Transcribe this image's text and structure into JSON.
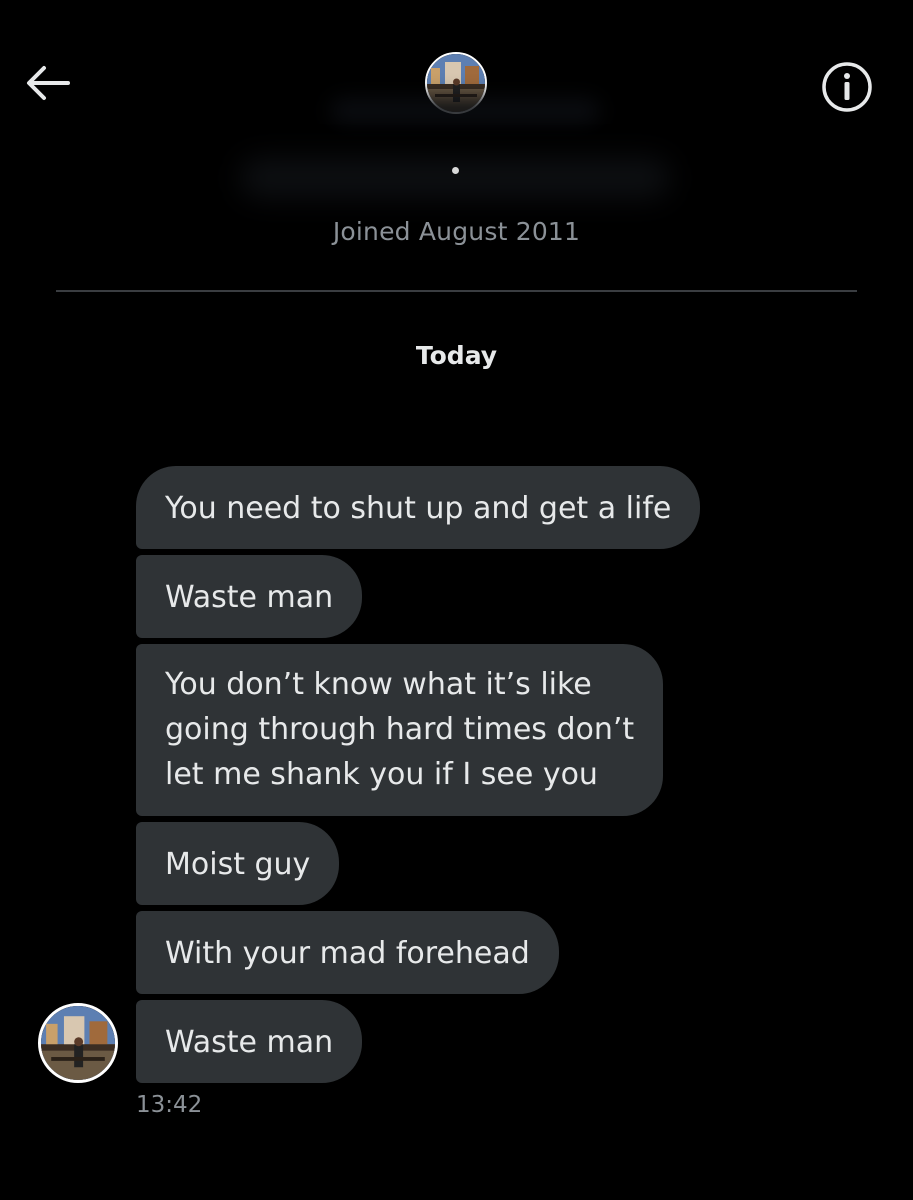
{
  "header": {
    "back_icon": "arrow-left-icon",
    "info_icon": "info-circle-icon",
    "joined_text": "Joined August 2011"
  },
  "conversation": {
    "day_label": "Today",
    "messages": [
      {
        "text": "You need to shut up and get a life"
      },
      {
        "text": "Waste man"
      },
      {
        "text": "You don’t know what it’s like\ngoing through hard times don’t\nlet me shank you if I see you"
      },
      {
        "text": "Moist guy"
      },
      {
        "text": "With your mad forehead"
      },
      {
        "text": "Waste man"
      }
    ],
    "timestamp": "13:42"
  },
  "colors": {
    "background": "#000000",
    "bubble": "#2f3336",
    "text": "#e7e9ea",
    "secondary_text": "#8b9197"
  }
}
